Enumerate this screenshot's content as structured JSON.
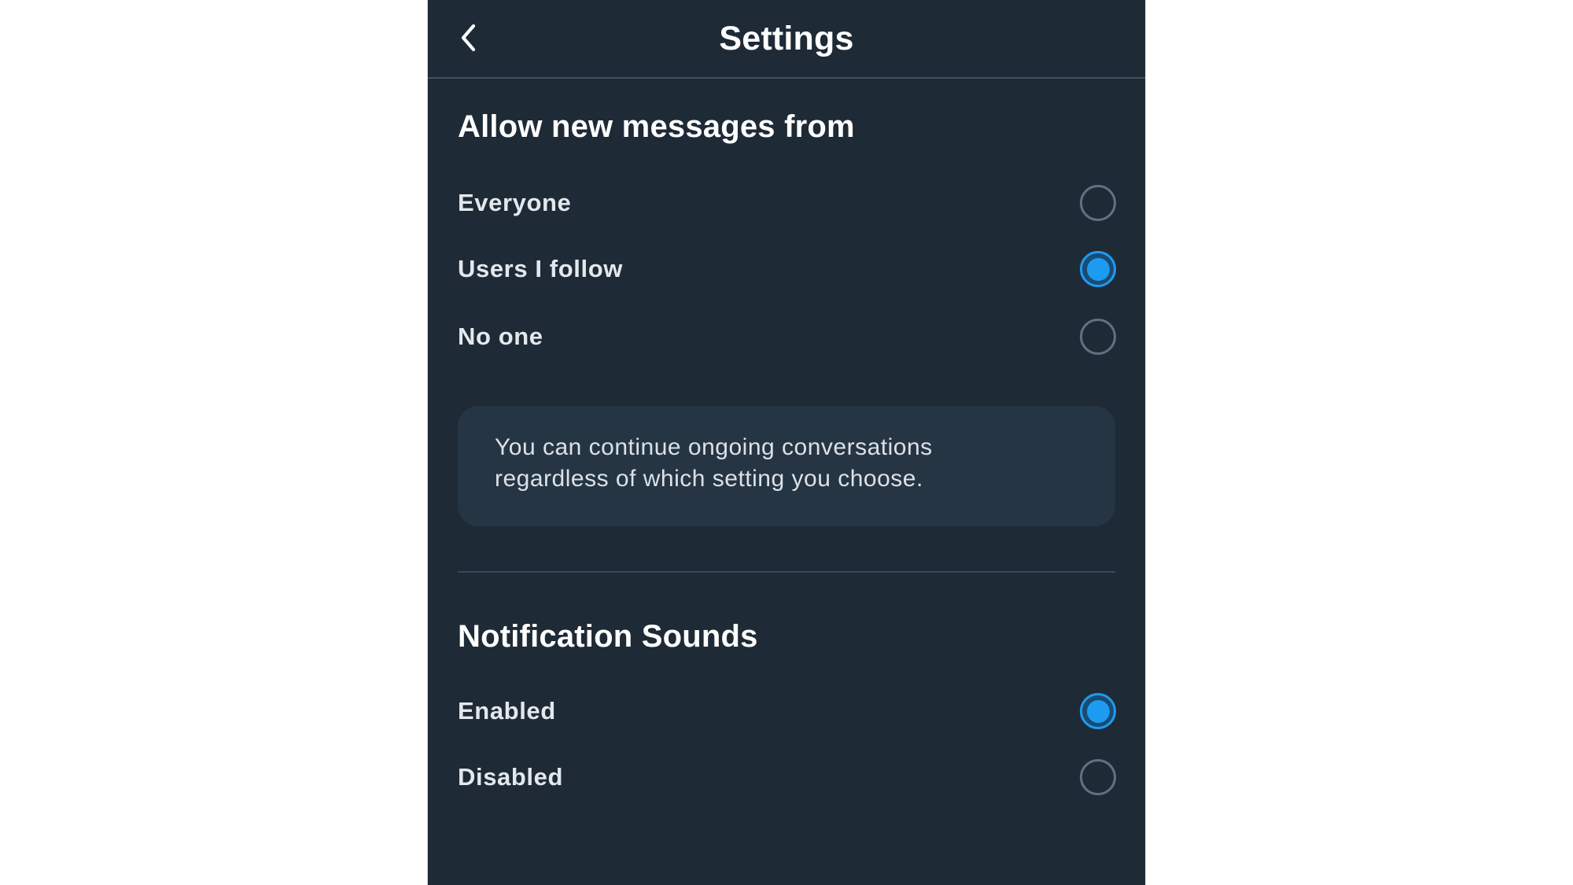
{
  "header": {
    "title": "Settings",
    "back_icon": "chevron-left-icon"
  },
  "sections": [
    {
      "heading": "Allow new messages from",
      "options": [
        {
          "label": "Everyone",
          "selected": false
        },
        {
          "label": "Users I follow",
          "selected": true
        },
        {
          "label": "No one",
          "selected": false
        }
      ],
      "info_text_line1": "You can continue ongoing conversations",
      "info_text_line2": "regardless of which setting you choose."
    },
    {
      "heading": "Notification Sounds",
      "options": [
        {
          "label": "Enabled",
          "selected": true
        },
        {
          "label": "Disabled",
          "selected": false
        }
      ]
    }
  ],
  "colors": {
    "panel_background": "#1e2a36",
    "accent": "#1d9bf0",
    "info_box_background": "#263544",
    "divider": "#38495a"
  }
}
